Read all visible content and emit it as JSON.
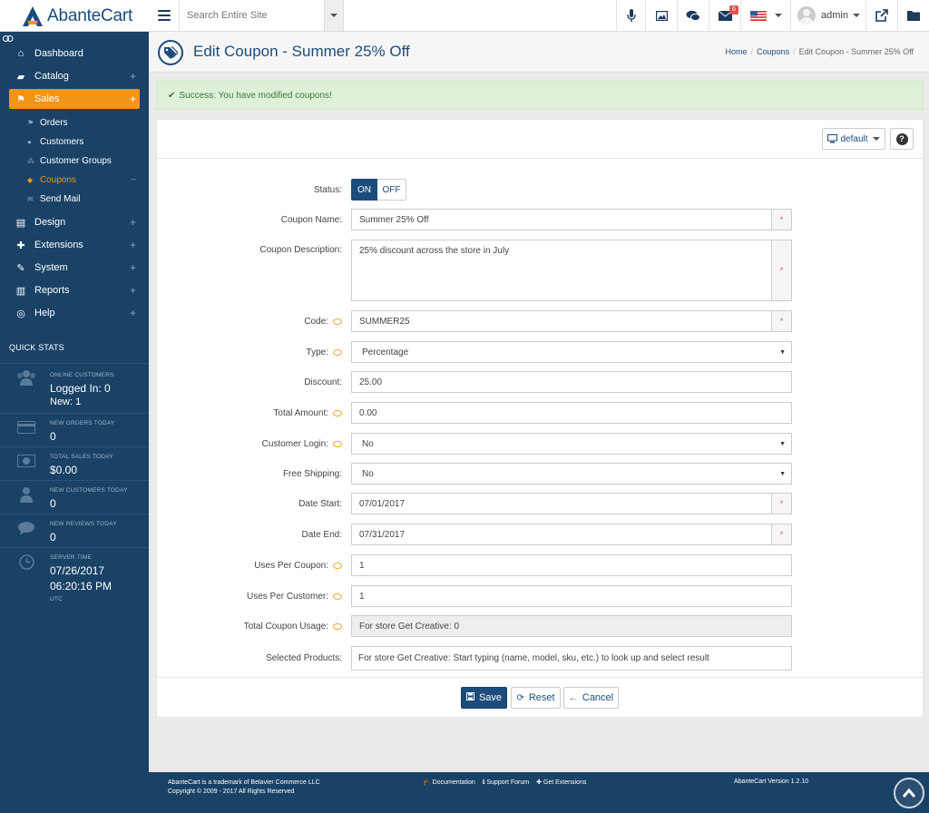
{
  "brand": {
    "name": "AbanteCart"
  },
  "topbar": {
    "search_placeholder": "Search Entire Site",
    "messages_badge": "6",
    "user_name": "admin"
  },
  "sidebar": {
    "items": [
      {
        "label": "Dashboard",
        "icon": "home-icon"
      },
      {
        "label": "Catalog",
        "icon": "folder-open-icon"
      },
      {
        "label": "Sales",
        "icon": "flag-icon"
      },
      {
        "label": "Design",
        "icon": "file-icon"
      },
      {
        "label": "Extensions",
        "icon": "puzzle-icon"
      },
      {
        "label": "System",
        "icon": "wrench-icon"
      },
      {
        "label": "Reports",
        "icon": "bar-chart-icon"
      },
      {
        "label": "Help",
        "icon": "lifebuoy-icon"
      }
    ],
    "sales_sub": [
      {
        "label": "Orders",
        "icon": "flag-icon"
      },
      {
        "label": "Customers",
        "icon": "users-icon"
      },
      {
        "label": "Customer Groups",
        "icon": "group-icon"
      },
      {
        "label": "Coupons",
        "icon": "tag-icon"
      },
      {
        "label": "Send Mail",
        "icon": "envelope-icon"
      }
    ],
    "quick_stats_title": "QUICK STATS",
    "stats": {
      "online_label": "ONLINE CUSTOMERS",
      "logged_in": "Logged In: 0",
      "new_online": "New: 1",
      "orders_label": "NEW ORDERS TODAY",
      "orders_val": "0",
      "sales_label": "TOTAL SALES TODAY",
      "sales_val": "$0.00",
      "customers_label": "NEW CUSTOMERS TODAY",
      "customers_val": "0",
      "reviews_label": "NEW REVIEWS TODAY",
      "reviews_val": "0",
      "time_label": "SERVER TIME",
      "date_val": "07/26/2017",
      "time_val": "06:20:16 PM",
      "tz": "UTC"
    }
  },
  "header": {
    "title": "Edit Coupon - Summer 25% Off",
    "breadcrumb": [
      "Home",
      "Coupons",
      "Edit Coupon - Summer 25% Off"
    ]
  },
  "alert": {
    "text": "Success: You have modified coupons!"
  },
  "panel": {
    "default_label": "default",
    "help_label": "?"
  },
  "form": {
    "status": {
      "label": "Status:",
      "on": "ON",
      "off": "OFF"
    },
    "coupon_name": {
      "label": "Coupon Name:",
      "value": "Summer 25% Off"
    },
    "description": {
      "label": "Coupon Description:",
      "value": "25% discount across the store in July"
    },
    "code": {
      "label": "Code:",
      "value": "SUMMER25"
    },
    "type": {
      "label": "Type:",
      "value": "Percentage"
    },
    "discount": {
      "label": "Discount:",
      "value": "25.00"
    },
    "total_amount": {
      "label": "Total Amount:",
      "value": "0.00"
    },
    "customer_login": {
      "label": "Customer Login:",
      "value": "No"
    },
    "free_shipping": {
      "label": "Free Shipping:",
      "value": "No"
    },
    "date_start": {
      "label": "Date Start:",
      "value": "07/01/2017"
    },
    "date_end": {
      "label": "Date End:",
      "value": "07/31/2017"
    },
    "uses_per_coupon": {
      "label": "Uses Per Coupon:",
      "value": "1"
    },
    "uses_per_customer": {
      "label": "Uses Per Customer:",
      "value": "1"
    },
    "total_usage": {
      "label": "Total Coupon Usage:",
      "value": "For store Get Creative: 0"
    },
    "selected_products": {
      "label": "Selected Products:",
      "placeholder": "For store Get Creative: Start typing (name, model, sku, etc.) to look up and select result"
    },
    "required_mark": "*"
  },
  "actions": {
    "save": "Save",
    "reset": "Reset",
    "cancel": "Cancel"
  },
  "footer": {
    "trademark": "AbanteCart is a trademark of Belavier Commerce LLC",
    "copyright": "Copyright © 2009 - 2017 All Rights Reserved",
    "links": [
      "Documentation",
      "Support Forum",
      "Get Extensions"
    ],
    "version": "AbanteCart Version 1.2.10"
  },
  "colors": {
    "sidebar": "#1a4267",
    "accent": "#f39519",
    "primary": "#1b4c7c"
  }
}
